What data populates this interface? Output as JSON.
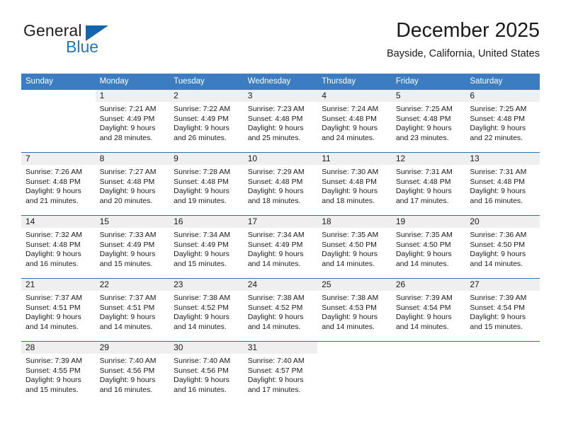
{
  "brand": {
    "name_part1": "General",
    "name_part2": "Blue",
    "flag_icon": "triangle-flag-icon",
    "accent_color": "#1266ad"
  },
  "header": {
    "month_title": "December 2025",
    "location": "Bayside, California, United States"
  },
  "calendar": {
    "header_bg": "#3b7dc0",
    "daynum_bg": "#efefef",
    "rule_color": "#2f6fb2",
    "weekday_headers": [
      "Sunday",
      "Monday",
      "Tuesday",
      "Wednesday",
      "Thursday",
      "Friday",
      "Saturday"
    ],
    "weeks": [
      [
        {
          "day": "",
          "sunrise": "",
          "sunset": "",
          "daylight_line1": "",
          "daylight_line2": ""
        },
        {
          "day": "1",
          "sunrise": "Sunrise: 7:21 AM",
          "sunset": "Sunset: 4:49 PM",
          "daylight_line1": "Daylight: 9 hours",
          "daylight_line2": "and 28 minutes."
        },
        {
          "day": "2",
          "sunrise": "Sunrise: 7:22 AM",
          "sunset": "Sunset: 4:49 PM",
          "daylight_line1": "Daylight: 9 hours",
          "daylight_line2": "and 26 minutes."
        },
        {
          "day": "3",
          "sunrise": "Sunrise: 7:23 AM",
          "sunset": "Sunset: 4:48 PM",
          "daylight_line1": "Daylight: 9 hours",
          "daylight_line2": "and 25 minutes."
        },
        {
          "day": "4",
          "sunrise": "Sunrise: 7:24 AM",
          "sunset": "Sunset: 4:48 PM",
          "daylight_line1": "Daylight: 9 hours",
          "daylight_line2": "and 24 minutes."
        },
        {
          "day": "5",
          "sunrise": "Sunrise: 7:25 AM",
          "sunset": "Sunset: 4:48 PM",
          "daylight_line1": "Daylight: 9 hours",
          "daylight_line2": "and 23 minutes."
        },
        {
          "day": "6",
          "sunrise": "Sunrise: 7:25 AM",
          "sunset": "Sunset: 4:48 PM",
          "daylight_line1": "Daylight: 9 hours",
          "daylight_line2": "and 22 minutes."
        }
      ],
      [
        {
          "day": "7",
          "sunrise": "Sunrise: 7:26 AM",
          "sunset": "Sunset: 4:48 PM",
          "daylight_line1": "Daylight: 9 hours",
          "daylight_line2": "and 21 minutes."
        },
        {
          "day": "8",
          "sunrise": "Sunrise: 7:27 AM",
          "sunset": "Sunset: 4:48 PM",
          "daylight_line1": "Daylight: 9 hours",
          "daylight_line2": "and 20 minutes."
        },
        {
          "day": "9",
          "sunrise": "Sunrise: 7:28 AM",
          "sunset": "Sunset: 4:48 PM",
          "daylight_line1": "Daylight: 9 hours",
          "daylight_line2": "and 19 minutes."
        },
        {
          "day": "10",
          "sunrise": "Sunrise: 7:29 AM",
          "sunset": "Sunset: 4:48 PM",
          "daylight_line1": "Daylight: 9 hours",
          "daylight_line2": "and 18 minutes."
        },
        {
          "day": "11",
          "sunrise": "Sunrise: 7:30 AM",
          "sunset": "Sunset: 4:48 PM",
          "daylight_line1": "Daylight: 9 hours",
          "daylight_line2": "and 18 minutes."
        },
        {
          "day": "12",
          "sunrise": "Sunrise: 7:31 AM",
          "sunset": "Sunset: 4:48 PM",
          "daylight_line1": "Daylight: 9 hours",
          "daylight_line2": "and 17 minutes."
        },
        {
          "day": "13",
          "sunrise": "Sunrise: 7:31 AM",
          "sunset": "Sunset: 4:48 PM",
          "daylight_line1": "Daylight: 9 hours",
          "daylight_line2": "and 16 minutes."
        }
      ],
      [
        {
          "day": "14",
          "sunrise": "Sunrise: 7:32 AM",
          "sunset": "Sunset: 4:48 PM",
          "daylight_line1": "Daylight: 9 hours",
          "daylight_line2": "and 16 minutes."
        },
        {
          "day": "15",
          "sunrise": "Sunrise: 7:33 AM",
          "sunset": "Sunset: 4:49 PM",
          "daylight_line1": "Daylight: 9 hours",
          "daylight_line2": "and 15 minutes."
        },
        {
          "day": "16",
          "sunrise": "Sunrise: 7:34 AM",
          "sunset": "Sunset: 4:49 PM",
          "daylight_line1": "Daylight: 9 hours",
          "daylight_line2": "and 15 minutes."
        },
        {
          "day": "17",
          "sunrise": "Sunrise: 7:34 AM",
          "sunset": "Sunset: 4:49 PM",
          "daylight_line1": "Daylight: 9 hours",
          "daylight_line2": "and 14 minutes."
        },
        {
          "day": "18",
          "sunrise": "Sunrise: 7:35 AM",
          "sunset": "Sunset: 4:50 PM",
          "daylight_line1": "Daylight: 9 hours",
          "daylight_line2": "and 14 minutes."
        },
        {
          "day": "19",
          "sunrise": "Sunrise: 7:35 AM",
          "sunset": "Sunset: 4:50 PM",
          "daylight_line1": "Daylight: 9 hours",
          "daylight_line2": "and 14 minutes."
        },
        {
          "day": "20",
          "sunrise": "Sunrise: 7:36 AM",
          "sunset": "Sunset: 4:50 PM",
          "daylight_line1": "Daylight: 9 hours",
          "daylight_line2": "and 14 minutes."
        }
      ],
      [
        {
          "day": "21",
          "sunrise": "Sunrise: 7:37 AM",
          "sunset": "Sunset: 4:51 PM",
          "daylight_line1": "Daylight: 9 hours",
          "daylight_line2": "and 14 minutes."
        },
        {
          "day": "22",
          "sunrise": "Sunrise: 7:37 AM",
          "sunset": "Sunset: 4:51 PM",
          "daylight_line1": "Daylight: 9 hours",
          "daylight_line2": "and 14 minutes."
        },
        {
          "day": "23",
          "sunrise": "Sunrise: 7:38 AM",
          "sunset": "Sunset: 4:52 PM",
          "daylight_line1": "Daylight: 9 hours",
          "daylight_line2": "and 14 minutes."
        },
        {
          "day": "24",
          "sunrise": "Sunrise: 7:38 AM",
          "sunset": "Sunset: 4:52 PM",
          "daylight_line1": "Daylight: 9 hours",
          "daylight_line2": "and 14 minutes."
        },
        {
          "day": "25",
          "sunrise": "Sunrise: 7:38 AM",
          "sunset": "Sunset: 4:53 PM",
          "daylight_line1": "Daylight: 9 hours",
          "daylight_line2": "and 14 minutes."
        },
        {
          "day": "26",
          "sunrise": "Sunrise: 7:39 AM",
          "sunset": "Sunset: 4:54 PM",
          "daylight_line1": "Daylight: 9 hours",
          "daylight_line2": "and 14 minutes."
        },
        {
          "day": "27",
          "sunrise": "Sunrise: 7:39 AM",
          "sunset": "Sunset: 4:54 PM",
          "daylight_line1": "Daylight: 9 hours",
          "daylight_line2": "and 15 minutes."
        }
      ],
      [
        {
          "day": "28",
          "sunrise": "Sunrise: 7:39 AM",
          "sunset": "Sunset: 4:55 PM",
          "daylight_line1": "Daylight: 9 hours",
          "daylight_line2": "and 15 minutes."
        },
        {
          "day": "29",
          "sunrise": "Sunrise: 7:40 AM",
          "sunset": "Sunset: 4:56 PM",
          "daylight_line1": "Daylight: 9 hours",
          "daylight_line2": "and 16 minutes."
        },
        {
          "day": "30",
          "sunrise": "Sunrise: 7:40 AM",
          "sunset": "Sunset: 4:56 PM",
          "daylight_line1": "Daylight: 9 hours",
          "daylight_line2": "and 16 minutes."
        },
        {
          "day": "31",
          "sunrise": "Sunrise: 7:40 AM",
          "sunset": "Sunset: 4:57 PM",
          "daylight_line1": "Daylight: 9 hours",
          "daylight_line2": "and 17 minutes."
        },
        {
          "day": "",
          "sunrise": "",
          "sunset": "",
          "daylight_line1": "",
          "daylight_line2": ""
        },
        {
          "day": "",
          "sunrise": "",
          "sunset": "",
          "daylight_line1": "",
          "daylight_line2": ""
        },
        {
          "day": "",
          "sunrise": "",
          "sunset": "",
          "daylight_line1": "",
          "daylight_line2": ""
        }
      ]
    ]
  }
}
